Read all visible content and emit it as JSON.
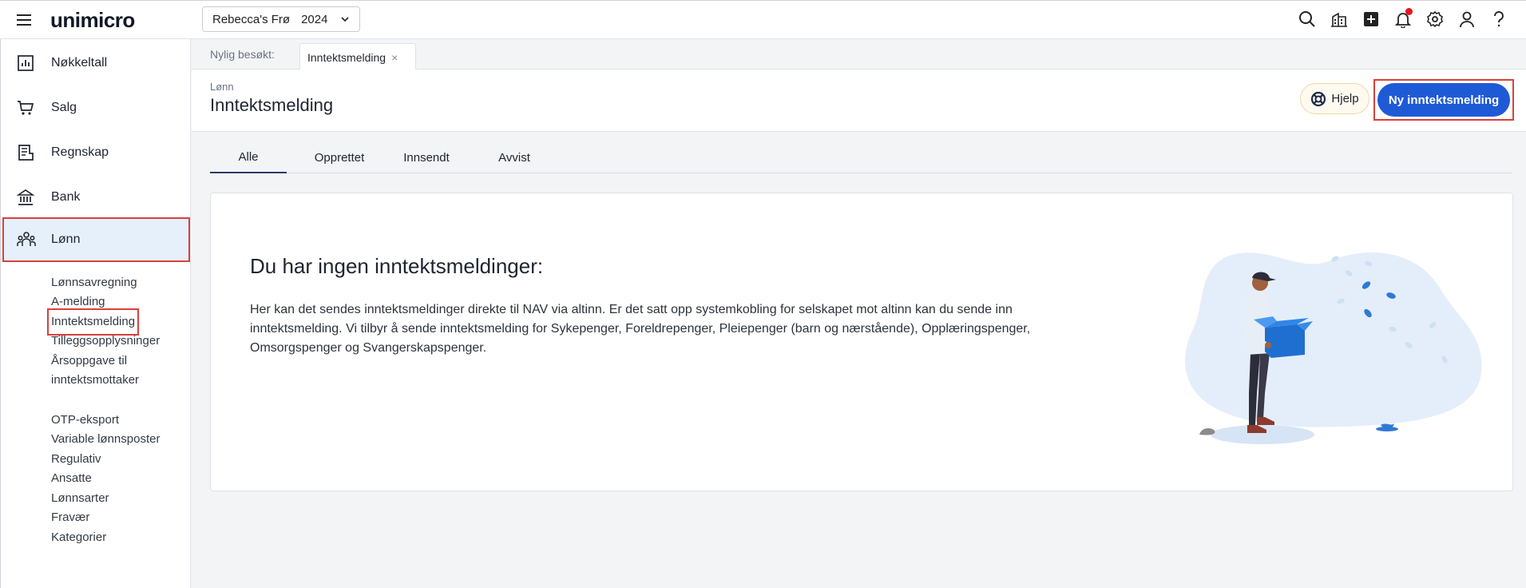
{
  "topbar": {
    "logo": "unimicro",
    "company": "Rebecca's Frø",
    "year": "2024",
    "icons": [
      "search-icon",
      "company-icon",
      "add-icon",
      "bell-icon",
      "gear-icon",
      "user-icon",
      "help-icon"
    ]
  },
  "sidebar": {
    "items": [
      {
        "label": "Nøkkeltall",
        "icon": "chart-icon"
      },
      {
        "label": "Salg",
        "icon": "cart-icon"
      },
      {
        "label": "Regnskap",
        "icon": "ledger-icon"
      },
      {
        "label": "Bank",
        "icon": "bank-icon"
      },
      {
        "label": "Lønn",
        "icon": "people-icon"
      }
    ],
    "subitems": [
      "Lønnsavregning",
      "A-melding",
      "Inntektsmelding",
      "Tilleggsopplysninger",
      "Årsoppgave til",
      "inntektsmottaker",
      "OTP-eksport",
      "Variable lønnsposter",
      "Regulativ",
      "Ansatte",
      "Lønnsarter",
      "Fravær",
      "Kategorier"
    ]
  },
  "recent": {
    "label": "Nylig besøkt:",
    "tab": "Inntektsmelding",
    "close": "×"
  },
  "header": {
    "breadcrumb": "Lønn",
    "title": "Inntektsmelding",
    "help_label": "Hjelp",
    "primary_label": "Ny inntektsmelding"
  },
  "tabs": [
    "Alle",
    "Opprettet",
    "Innsendt",
    "Avvist"
  ],
  "empty": {
    "title": "Du har ingen inntektsmeldinger:",
    "text": "Her kan det sendes inntektsmeldinger direkte til NAV via altinn. Er det satt opp systemkobling for selskapet mot altinn kan du sende inn inntektsmelding. Vi tilbyr å sende inntektsmelding for Sykepenger, Foreldrepenger, Pleiepenger (barn og nærstående), Opplæringspenger, Omsorgspenger og Svangerskapspenger."
  },
  "colors": {
    "primary": "#1f5ad6",
    "active_bg": "#e6f0fb",
    "highlight": "#d9403b",
    "notification": "#e5141e"
  }
}
